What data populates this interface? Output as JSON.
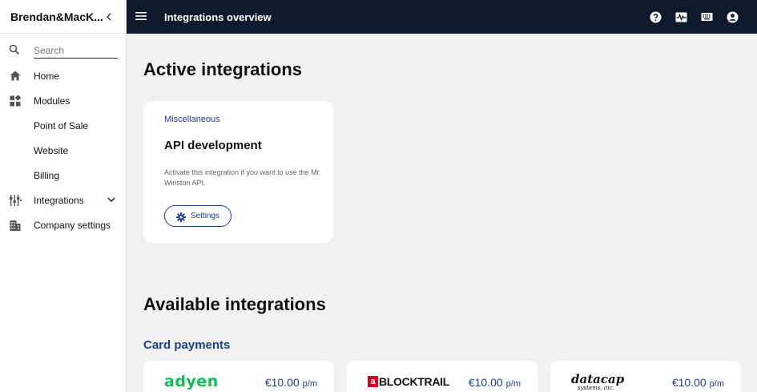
{
  "brand": {
    "name": "Brendan&MacK..."
  },
  "search": {
    "placeholder": "Search",
    "value": ""
  },
  "sidebar": {
    "items": [
      {
        "label": "Home",
        "icon": "home-icon"
      },
      {
        "label": "Modules",
        "icon": "modules-icon"
      },
      {
        "label": "Point of Sale"
      },
      {
        "label": "Website"
      },
      {
        "label": "Billing"
      },
      {
        "label": "Integrations",
        "icon": "integrations-icon",
        "expandable": true
      },
      {
        "label": "Company settings",
        "icon": "building-icon"
      }
    ]
  },
  "header": {
    "title": "Integrations overview",
    "actions": [
      "help-icon",
      "activity-icon",
      "keyboard-icon",
      "account-icon"
    ]
  },
  "active": {
    "heading": "Active integrations",
    "cards": [
      {
        "category": "Miscellaneous",
        "title": "API development",
        "description": "Activate this integration if you want to use the Mr. Winston API.",
        "button": "Settings"
      }
    ]
  },
  "available": {
    "heading": "Available integrations",
    "section": "Card payments",
    "cards": [
      {
        "logo": "adyen",
        "price": "€10.00",
        "unit": "p/m"
      },
      {
        "logo": "BLOCKTRAIL",
        "logo_mark": "a",
        "price": "€10.00",
        "unit": "p/m"
      },
      {
        "logo": "datacap",
        "logo_sub": "systems, inc.",
        "price": "€10.00",
        "unit": "p/m"
      }
    ]
  },
  "colors": {
    "topbar": "#0f1a2d",
    "accent": "#1d3f8f",
    "adyen": "#0abf53",
    "blocktrail": "#d6001c",
    "datacap_red": "#d0021b"
  }
}
